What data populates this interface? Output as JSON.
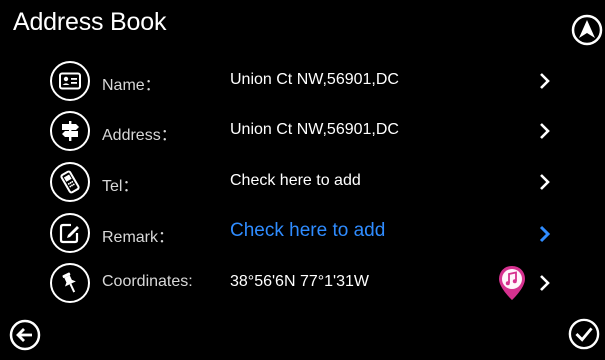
{
  "header": {
    "title": "Address Book"
  },
  "rows": [
    {
      "label": "Name：",
      "value": "Union Ct NW,56901,DC",
      "icon": "id-card-icon"
    },
    {
      "label": "Address：",
      "value": "Union Ct NW,56901,DC",
      "icon": "signpost-icon"
    },
    {
      "label": "Tel：",
      "value": "Check here to add",
      "icon": "phone-icon"
    },
    {
      "label": "Remark：",
      "value": "Check here to add",
      "icon": "edit-icon"
    },
    {
      "label": "Coordinates:",
      "value": "38°56'6N 77°1'31W",
      "icon": "pin-icon"
    }
  ],
  "colors": {
    "accent": "#2f8cff",
    "badge": "#d6318f"
  }
}
